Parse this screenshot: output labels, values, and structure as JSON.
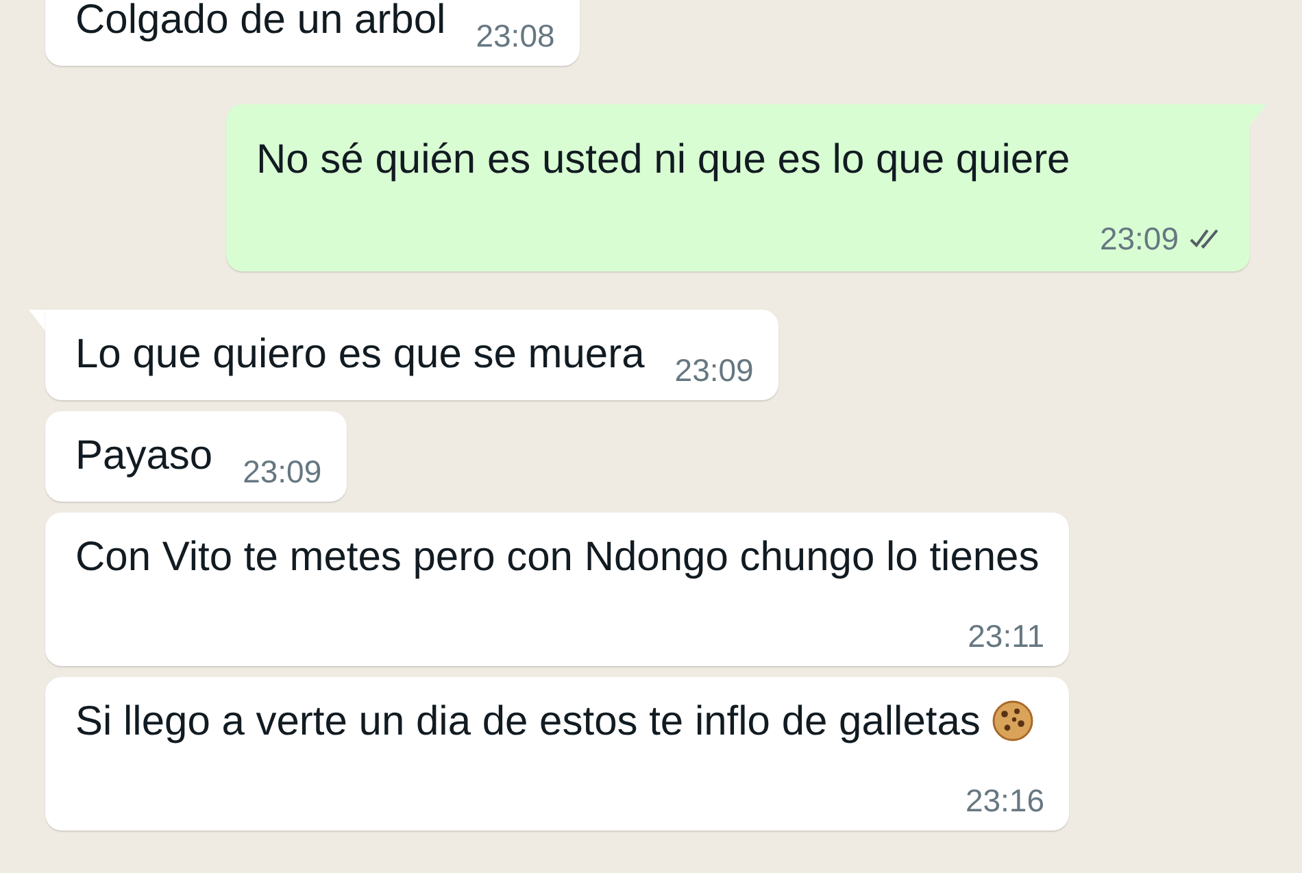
{
  "messages": [
    {
      "kind": "incoming",
      "text": "Colgado de un arbol",
      "time": "23:08",
      "tail": false
    },
    {
      "kind": "outgoing",
      "text": "No sé quién es usted ni que es lo que quiere",
      "time": "23:09",
      "tail": true,
      "double_tick": true
    },
    {
      "kind": "incoming",
      "text": "Lo que quiero es que se muera",
      "time": "23:09",
      "tail": true
    },
    {
      "kind": "incoming",
      "text": "Payaso",
      "time": "23:09",
      "tail": false
    },
    {
      "kind": "incoming",
      "text": "Con Vito te metes pero con Ndongo chungo lo tienes",
      "time": "23:11",
      "tail": false
    },
    {
      "kind": "incoming",
      "text": "Si llego a verte un dia de estos te inflo de galletas",
      "time": "23:16",
      "tail": false,
      "cookie_emoji": true
    }
  ]
}
